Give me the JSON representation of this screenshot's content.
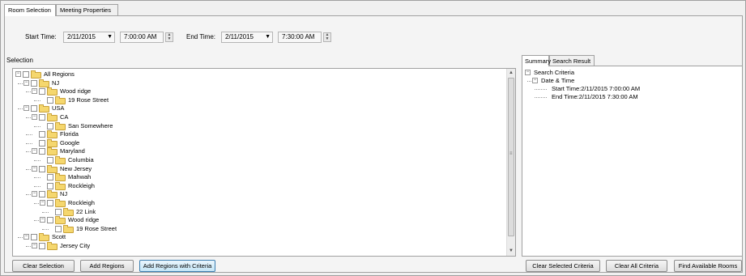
{
  "tabs": [
    {
      "label": "Room Selection",
      "active": true
    },
    {
      "label": "Meeting Properties",
      "active": false
    }
  ],
  "time": {
    "start_label": "Start Time:",
    "start_date": "2/11/2015",
    "start_time": "7:00:00 AM",
    "end_label": "End Time:",
    "end_date": "2/11/2015",
    "end_time": "7:30:00 AM"
  },
  "selection": {
    "title": "Selection",
    "tree": [
      {
        "label": "All Regions",
        "level": 0,
        "expander": "minus"
      },
      {
        "label": "NJ",
        "level": 1,
        "expander": "minus"
      },
      {
        "label": "Wood ridge",
        "level": 2,
        "expander": "minus"
      },
      {
        "label": "19 Rose Street",
        "level": 3,
        "expander": ""
      },
      {
        "label": "USA",
        "level": 1,
        "expander": "minus"
      },
      {
        "label": "CA",
        "level": 2,
        "expander": "minus"
      },
      {
        "label": "San Somewhere",
        "level": 3,
        "expander": ""
      },
      {
        "label": "Florida",
        "level": 2,
        "expander": ""
      },
      {
        "label": "Google",
        "level": 2,
        "expander": ""
      },
      {
        "label": "Maryland",
        "level": 2,
        "expander": "minus"
      },
      {
        "label": "Columbia",
        "level": 3,
        "expander": ""
      },
      {
        "label": "New Jersey",
        "level": 2,
        "expander": "minus"
      },
      {
        "label": "Mahwah",
        "level": 3,
        "expander": ""
      },
      {
        "label": "Rockleigh",
        "level": 3,
        "expander": ""
      },
      {
        "label": "NJ",
        "level": 2,
        "expander": "minus"
      },
      {
        "label": "Rockleigh",
        "level": 3,
        "expander": "minus"
      },
      {
        "label": "22 Link",
        "level": 4,
        "expander": ""
      },
      {
        "label": "Wood ridge",
        "level": 3,
        "expander": "minus"
      },
      {
        "label": "19 Rose Street",
        "level": 4,
        "expander": ""
      },
      {
        "label": "Scott",
        "level": 1,
        "expander": "minus"
      },
      {
        "label": "Jersey City",
        "level": 2,
        "expander": "minus"
      }
    ]
  },
  "right_tabs": [
    {
      "label": "Summary",
      "active": true
    },
    {
      "label": "Search Result",
      "active": false
    }
  ],
  "summary_tree": [
    {
      "label": "Search Criteria",
      "level": 0,
      "expander": "minus"
    },
    {
      "label": "Date & Time",
      "level": 1,
      "expander": "minus"
    },
    {
      "label": "Start Time:2/11/2015 7:00:00 AM",
      "level": 2,
      "expander": ""
    },
    {
      "label": "End Time:2/11/2015 7:30:00 AM",
      "level": 2,
      "expander": ""
    }
  ],
  "buttons": {
    "clear_selection": "Clear Selection",
    "add_regions": "Add Regions",
    "add_regions_criteria": "Add Regions with Criteria",
    "clear_selected_criteria": "Clear Selected Criteria",
    "clear_all_criteria": "Clear All Criteria",
    "find_available_rooms": "Find Available Rooms"
  },
  "glyphs": {
    "dropdown": "▼",
    "spin_up": "▲",
    "spin_down": "▼",
    "scroll_up": "▲",
    "scroll_down": "▼",
    "thumb_grip": "≡",
    "expander_minus": "−"
  },
  "icons": {
    "folder": "folder-icon",
    "checkbox": "checkbox-icon",
    "expander": "collapse-icon"
  }
}
